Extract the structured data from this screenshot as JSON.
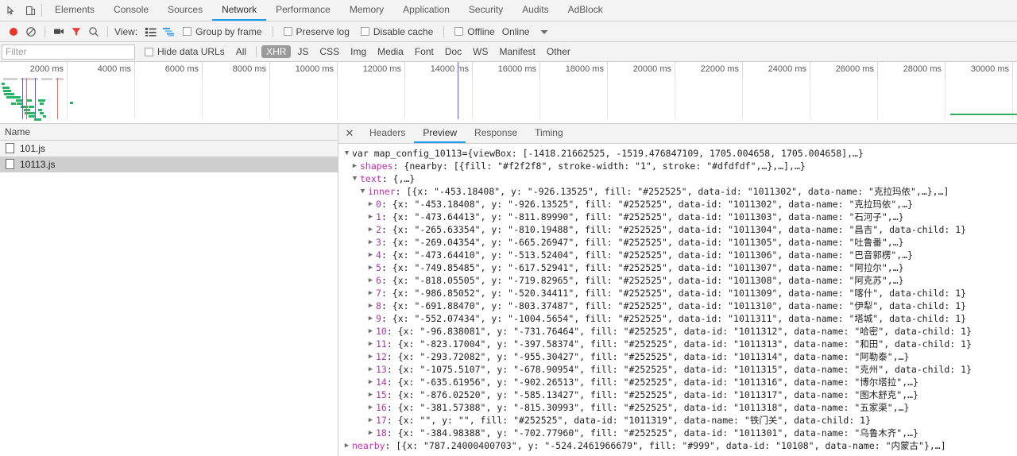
{
  "window": {
    "inspect_icon": "inspect-element-icon",
    "device_icon": "device-toolbar-icon"
  },
  "tabs": [
    {
      "label": "Elements",
      "active": false
    },
    {
      "label": "Console",
      "active": false
    },
    {
      "label": "Sources",
      "active": false
    },
    {
      "label": "Network",
      "active": true
    },
    {
      "label": "Performance",
      "active": false
    },
    {
      "label": "Memory",
      "active": false
    },
    {
      "label": "Application",
      "active": false
    },
    {
      "label": "Security",
      "active": false
    },
    {
      "label": "Audits",
      "active": false
    },
    {
      "label": "AdBlock",
      "active": false
    }
  ],
  "toolbar": {
    "record_icon": "record-circle-icon",
    "clear_icon": "clear-prohibited-icon",
    "screenshot_icon": "camera-icon",
    "filter_icon": "funnel-filter-icon",
    "search_icon": "search-icon",
    "view_label": "View:",
    "view_list_icon": "list-view-icon",
    "view_waterfall_icon": "waterfall-view-icon",
    "group_by_frame": "Group by frame",
    "preserve_log": "Preserve log",
    "disable_cache": "Disable cache",
    "offline": "Offline",
    "online": "Online",
    "more_icon": "chevron-down-icon"
  },
  "filterbar": {
    "placeholder": "Filter",
    "value": "",
    "hide_data_urls": "Hide data URLs",
    "types": [
      {
        "label": "All",
        "active": false
      },
      {
        "label": "XHR",
        "active": true
      },
      {
        "label": "JS",
        "active": false
      },
      {
        "label": "CSS",
        "active": false
      },
      {
        "label": "Img",
        "active": false
      },
      {
        "label": "Media",
        "active": false
      },
      {
        "label": "Font",
        "active": false
      },
      {
        "label": "Doc",
        "active": false
      },
      {
        "label": "WS",
        "active": false
      },
      {
        "label": "Manifest",
        "active": false
      },
      {
        "label": "Other",
        "active": false
      }
    ]
  },
  "overview": {
    "ticks": [
      "2000 ms",
      "4000 ms",
      "6000 ms",
      "8000 ms",
      "10000 ms",
      "12000 ms",
      "14000 ms",
      "16000 ms",
      "18000 ms",
      "20000 ms",
      "22000 ms",
      "24000 ms",
      "26000 ms",
      "28000 ms",
      "30000 ms"
    ],
    "colors": {
      "request_bar": "#26b562",
      "dom_content_loaded": "#5b5bd6",
      "load_event": "#f0655c"
    }
  },
  "requests": {
    "column_name": "Name",
    "rows": [
      {
        "name": "101.js",
        "selected": false
      },
      {
        "name": "10113.js",
        "selected": true
      }
    ]
  },
  "detail": {
    "close_label": "✕",
    "tabs": [
      {
        "label": "Headers",
        "active": false
      },
      {
        "label": "Preview",
        "active": true
      },
      {
        "label": "Response",
        "active": false
      },
      {
        "label": "Timing",
        "active": false
      }
    ]
  },
  "preview": {
    "root": "var map_config_10113={viewBox: [-1418.21662525, -1519.476847109, 1705.004658, 1705.004658],…}",
    "shapes": {
      "key": "shapes",
      "value": ": {nearby: [{fill: \"#f2f2f8\", stroke-width: \"1\", stroke: \"#dfdfdf\",…},…],…}"
    },
    "text": {
      "key": "text",
      "value": ": {,…}"
    },
    "inner": {
      "key": "inner",
      "value": ": [{x: \"-453.18408\", y: \"-926.13525\", fill: \"#252525\", data-id: \"1011302\", data-name: \"克拉玛依\",…},…]"
    },
    "items": [
      {
        "index": "0",
        "value": ": {x: \"-453.18408\", y: \"-926.13525\", fill: \"#252525\", data-id: \"1011302\", data-name: \"克拉玛依\",…}"
      },
      {
        "index": "1",
        "value": ": {x: \"-473.64413\", y: \"-811.89990\", fill: \"#252525\", data-id: \"1011303\", data-name: \"石河子\",…}"
      },
      {
        "index": "2",
        "value": ": {x: \"-265.63354\", y: \"-810.19488\", fill: \"#252525\", data-id: \"1011304\", data-name: \"昌吉\", data-child: 1}"
      },
      {
        "index": "3",
        "value": ": {x: \"-269.04354\", y: \"-665.26947\", fill: \"#252525\", data-id: \"1011305\", data-name: \"吐鲁番\",…}"
      },
      {
        "index": "4",
        "value": ": {x: \"-473.64410\", y: \"-513.52404\", fill: \"#252525\", data-id: \"1011306\", data-name: \"巴音郭楞\",…}"
      },
      {
        "index": "5",
        "value": ": {x: \"-749.85485\", y: \"-617.52941\", fill: \"#252525\", data-id: \"1011307\", data-name: \"阿拉尔\",…}"
      },
      {
        "index": "6",
        "value": ": {x: \"-818.05505\", y: \"-719.82965\", fill: \"#252525\", data-id: \"1011308\", data-name: \"阿克苏\",…}"
      },
      {
        "index": "7",
        "value": ": {x: \"-986.85052\", y: \"-520.34411\", fill: \"#252525\", data-id: \"1011309\", data-name: \"喀什\", data-child: 1}"
      },
      {
        "index": "8",
        "value": ": {x: \"-691.88470\", y: \"-803.37487\", fill: \"#252525\", data-id: \"1011310\", data-name: \"伊犁\", data-child: 1}"
      },
      {
        "index": "9",
        "value": ": {x: \"-552.07434\", y: \"-1004.5654\", fill: \"#252525\", data-id: \"1011311\", data-name: \"塔城\", data-child: 1}"
      },
      {
        "index": "10",
        "value": ": {x: \"-96.838081\", y: \"-731.76464\", fill: \"#252525\", data-id: \"1011312\", data-name: \"哈密\", data-child: 1}"
      },
      {
        "index": "11",
        "value": ": {x: \"-823.17004\", y: \"-397.58374\", fill: \"#252525\", data-id: \"1011313\", data-name: \"和田\", data-child: 1}"
      },
      {
        "index": "12",
        "value": ": {x: \"-293.72082\", y: \"-955.30427\", fill: \"#252525\", data-id: \"1011314\", data-name: \"阿勒泰\",…}"
      },
      {
        "index": "13",
        "value": ": {x: \"-1075.5107\", y: \"-678.90954\", fill: \"#252525\", data-id: \"1011315\", data-name: \"克州\", data-child: 1}"
      },
      {
        "index": "14",
        "value": ": {x: \"-635.61956\", y: \"-902.26513\", fill: \"#252525\", data-id: \"1011316\", data-name: \"博尔塔拉\",…}"
      },
      {
        "index": "15",
        "value": ": {x: \"-876.02520\", y: \"-585.13427\", fill: \"#252525\", data-id: \"1011317\", data-name: \"图木舒克\",…}"
      },
      {
        "index": "16",
        "value": ": {x: \"-381.57388\", y: \"-815.30993\", fill: \"#252525\", data-id: \"1011318\", data-name: \"五家渠\",…}"
      },
      {
        "index": "17",
        "value": ": {x: \"\", y: \"\", fill: \"#252525\", data-id: \"1011319\", data-name: \"铁门关\", data-child: 1}"
      },
      {
        "index": "18",
        "value": ": {x: \"-384.98388\", y: \"-702.77960\", fill: \"#252525\", data-id: \"1011301\", data-name: \"乌鲁木齐\",…}"
      }
    ],
    "nearby": {
      "key": "nearby",
      "value": ": [{x: \"787.24000400703\", y: \"-524.2461966679\", fill: \"#999\", data-id: \"10108\", data-name: \"内蒙古\"},…]"
    }
  }
}
